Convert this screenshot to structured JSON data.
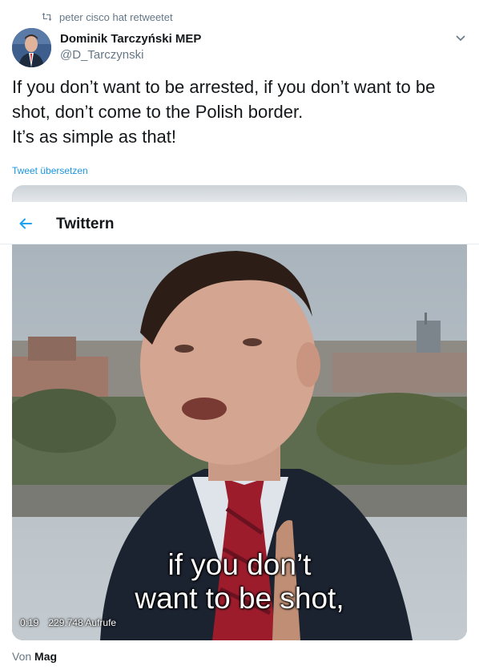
{
  "retweet": {
    "label": "peter cisco hat retweetet",
    "icon": "retweet-icon"
  },
  "author": {
    "name": "Dominik Tarczyński MEP",
    "handle": "@D_Tarczynski",
    "avatar_icon": "avatar-photo"
  },
  "tweet": {
    "lines": [
      "If you don’t want to be arrested, if you don’t want to be",
      "shot, don’t come to the Polish border.",
      "It’s as simple as that!"
    ],
    "translate_label": "Tweet übersetzen"
  },
  "app_header": {
    "title": "Twittern",
    "back_icon": "back-arrow-icon"
  },
  "video": {
    "subtitle_line1": "if you don’t",
    "subtitle_line2": "want to be shot,",
    "duration": "0:19",
    "views": "229.748 Aufrufe"
  },
  "source": {
    "prefix": "Von",
    "name": "Mag"
  },
  "colors": {
    "accent": "#1b95e0",
    "secondary_text": "#657786",
    "primary_text": "#14171a"
  }
}
